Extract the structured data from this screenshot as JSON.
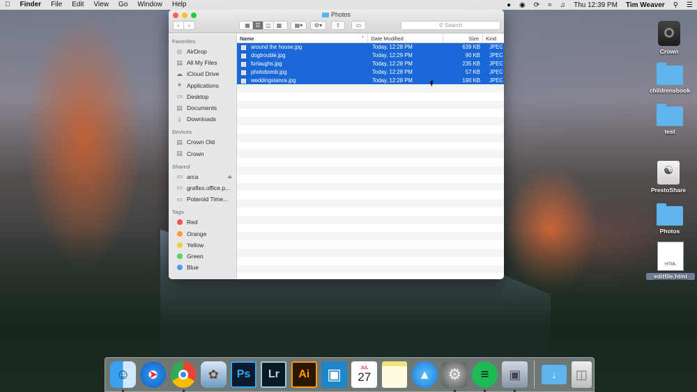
{
  "menubar": {
    "items": [
      "Finder",
      "File",
      "Edit",
      "View",
      "Go",
      "Window",
      "Help"
    ],
    "clock": "Thu 12:39 PM",
    "user": "Tim Weaver"
  },
  "window": {
    "title": "Photos",
    "search_placeholder": "Search",
    "sidebar": {
      "favorites_header": "Favorites",
      "favorites": [
        "AirDrop",
        "All My Files",
        "iCloud Drive",
        "Applications",
        "Desktop",
        "Documents",
        "Downloads"
      ],
      "devices_header": "Devices",
      "devices": [
        "Crown Old",
        "Crown"
      ],
      "shared_header": "Shared",
      "shared": [
        "arca",
        "graflex.office.p...",
        "Polaroid Time..."
      ],
      "tags_header": "Tags",
      "tags": [
        {
          "label": "Red",
          "color": "#f2564e"
        },
        {
          "label": "Orange",
          "color": "#f79a3a"
        },
        {
          "label": "Yellow",
          "color": "#f4d03f"
        },
        {
          "label": "Green",
          "color": "#5bd25b"
        },
        {
          "label": "Blue",
          "color": "#4aa0f0"
        }
      ]
    },
    "columns": {
      "name": "Name",
      "date": "Date Modified",
      "size": "Size",
      "kind": "Kind"
    },
    "files": [
      {
        "name": "around the house.jpg",
        "date": "Today, 12:28 PM",
        "size": "639 KB",
        "kind": "JPEG"
      },
      {
        "name": "dogtrouble.jpg",
        "date": "Today, 12:29 PM",
        "size": "90 KB",
        "kind": "JPEG"
      },
      {
        "name": "forlaughs.jpg",
        "date": "Today, 12:28 PM",
        "size": "235 KB",
        "kind": "JPEG"
      },
      {
        "name": "photobomb.jpg",
        "date": "Today, 12:28 PM",
        "size": "57 KB",
        "kind": "JPEG"
      },
      {
        "name": "weddingstance.jpg",
        "date": "Today, 12:28 PM",
        "size": "190 KB",
        "kind": "JPEG"
      }
    ]
  },
  "desktop": {
    "crown": "Crown",
    "childrensbook": "childrensbook",
    "test": "test",
    "prestoshare": "PrestoShare",
    "photos": "Photos",
    "editfile": "editfile.html",
    "editfile_badge": "HTML"
  },
  "dock": {
    "calendar_month": "JUL",
    "calendar_day": "27",
    "ps": "Ps",
    "lr": "Lr",
    "ai": "Ai"
  }
}
